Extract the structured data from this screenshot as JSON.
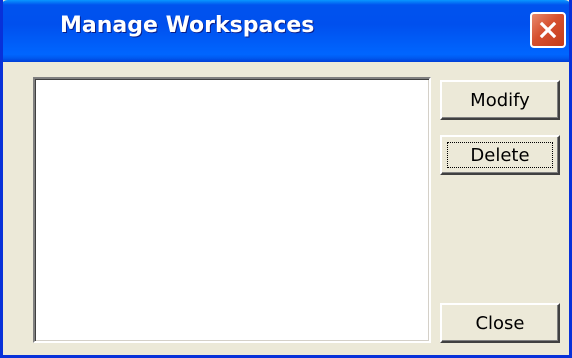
{
  "window": {
    "title": "Manage Workspaces"
  },
  "titlebar": {
    "close_icon": "close-icon"
  },
  "workspace_list": {
    "items": []
  },
  "buttons": {
    "modify_label": "Modify",
    "delete_label": "Delete",
    "close_label": "Close"
  },
  "colors": {
    "titlebar": "#0054e3",
    "dialog_background": "#ece9d8",
    "close_button": "#d6502e",
    "list_background": "#ffffff"
  }
}
